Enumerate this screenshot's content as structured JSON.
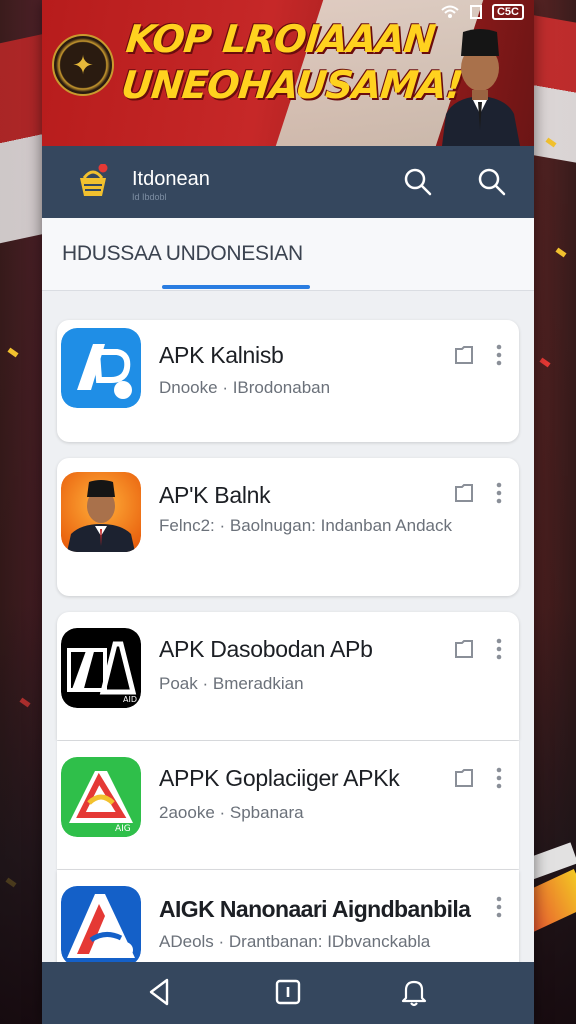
{
  "banner": {
    "headline_line1": "KOP LROIAAAN",
    "headline_line2": "UNEOHAUSAMA!",
    "status_battery": "C5C"
  },
  "appbar": {
    "title": "Itdonean",
    "subtitle": "Id Ibdobl"
  },
  "tabs": {
    "active_label": "HDUSSAA UNDONESIAN"
  },
  "apps": [
    {
      "name": "APK Kalnisb",
      "meta": "Dnooke · IBrodonaban",
      "icon": "ap-blue-icon"
    },
    {
      "name": "AP'K Balnk",
      "meta": "Felnc2: · Baolnugan: Indanban Andack",
      "icon": "person-portrait-icon"
    },
    {
      "name": "APK Dasobodan APb",
      "meta": "Poak · Bmeradkian",
      "icon": "black-a-icon"
    },
    {
      "name": "APPK Goplaciiger APKk",
      "meta": "2aooke · Spbanara",
      "icon": "green-a-icon"
    },
    {
      "name": "AIGK Nanonaari Aigndbanbila",
      "meta": "ADeols · Drantbanan: IDbvanckabla",
      "icon": "blue-red-a-icon"
    }
  ],
  "colors": {
    "appbar": "#35475e",
    "accent": "#2a7de1",
    "banner_red": "#c62828",
    "headline_yellow": "#ffd21f"
  }
}
